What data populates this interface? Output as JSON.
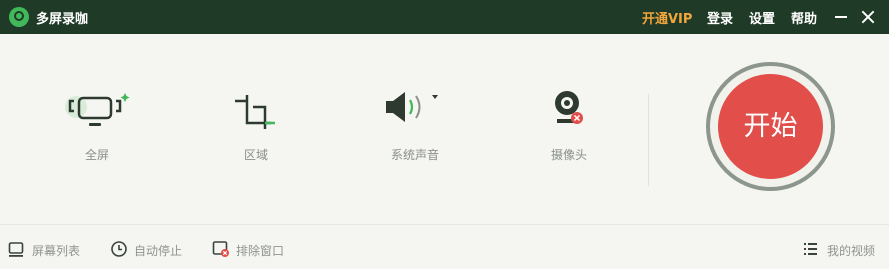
{
  "titlebar": {
    "app_title": "多屏录咖",
    "vip": "开通VIP",
    "login": "登录",
    "settings": "设置",
    "help": "帮助"
  },
  "tools": {
    "fullscreen": "全屏",
    "region": "区域",
    "system_sound": "系统声音",
    "camera": "摄像头"
  },
  "start_label": "开始",
  "bottombar": {
    "screen_list": "屏幕列表",
    "auto_stop": "自动停止",
    "exclude_window": "排除窗口",
    "my_videos": "我的视频"
  },
  "icons": {
    "fullscreen": "monitor-icon",
    "region": "crop-icon",
    "system_sound": "speaker-icon",
    "camera": "webcam-icon"
  },
  "colors": {
    "titlebar_bg": "#1f3a26",
    "vip": "#f2a63b",
    "start_button": "#e24e49",
    "icon_green": "#41b85a"
  }
}
